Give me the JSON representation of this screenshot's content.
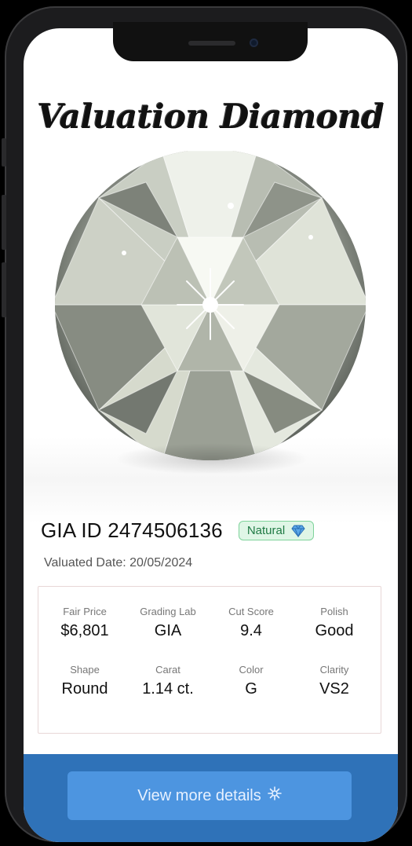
{
  "app": {
    "title": "Valuation Diamond"
  },
  "certificate": {
    "id_text": "GIA ID 2474506136",
    "badge_label": "Natural",
    "valuated_date": "Valuated Date: 20/05/2024"
  },
  "specs": [
    {
      "label": "Fair Price",
      "value": "$6,801"
    },
    {
      "label": "Grading Lab",
      "value": "GIA"
    },
    {
      "label": "Cut Score",
      "value": "9.4"
    },
    {
      "label": "Polish",
      "value": "Good"
    },
    {
      "label": "Shape",
      "value": "Round"
    },
    {
      "label": "Carat",
      "value": "1.14 ct."
    },
    {
      "label": "Color",
      "value": "G"
    },
    {
      "label": "Clarity",
      "value": "VS2"
    }
  ],
  "footer": {
    "button_label": "View more details",
    "button_icon": "sparkle-icon"
  },
  "colors": {
    "accent_blue": "#2f72b8",
    "button_blue": "#4d95e0",
    "badge_green": "#1f7a44",
    "badge_bg": "#dff6e6"
  }
}
